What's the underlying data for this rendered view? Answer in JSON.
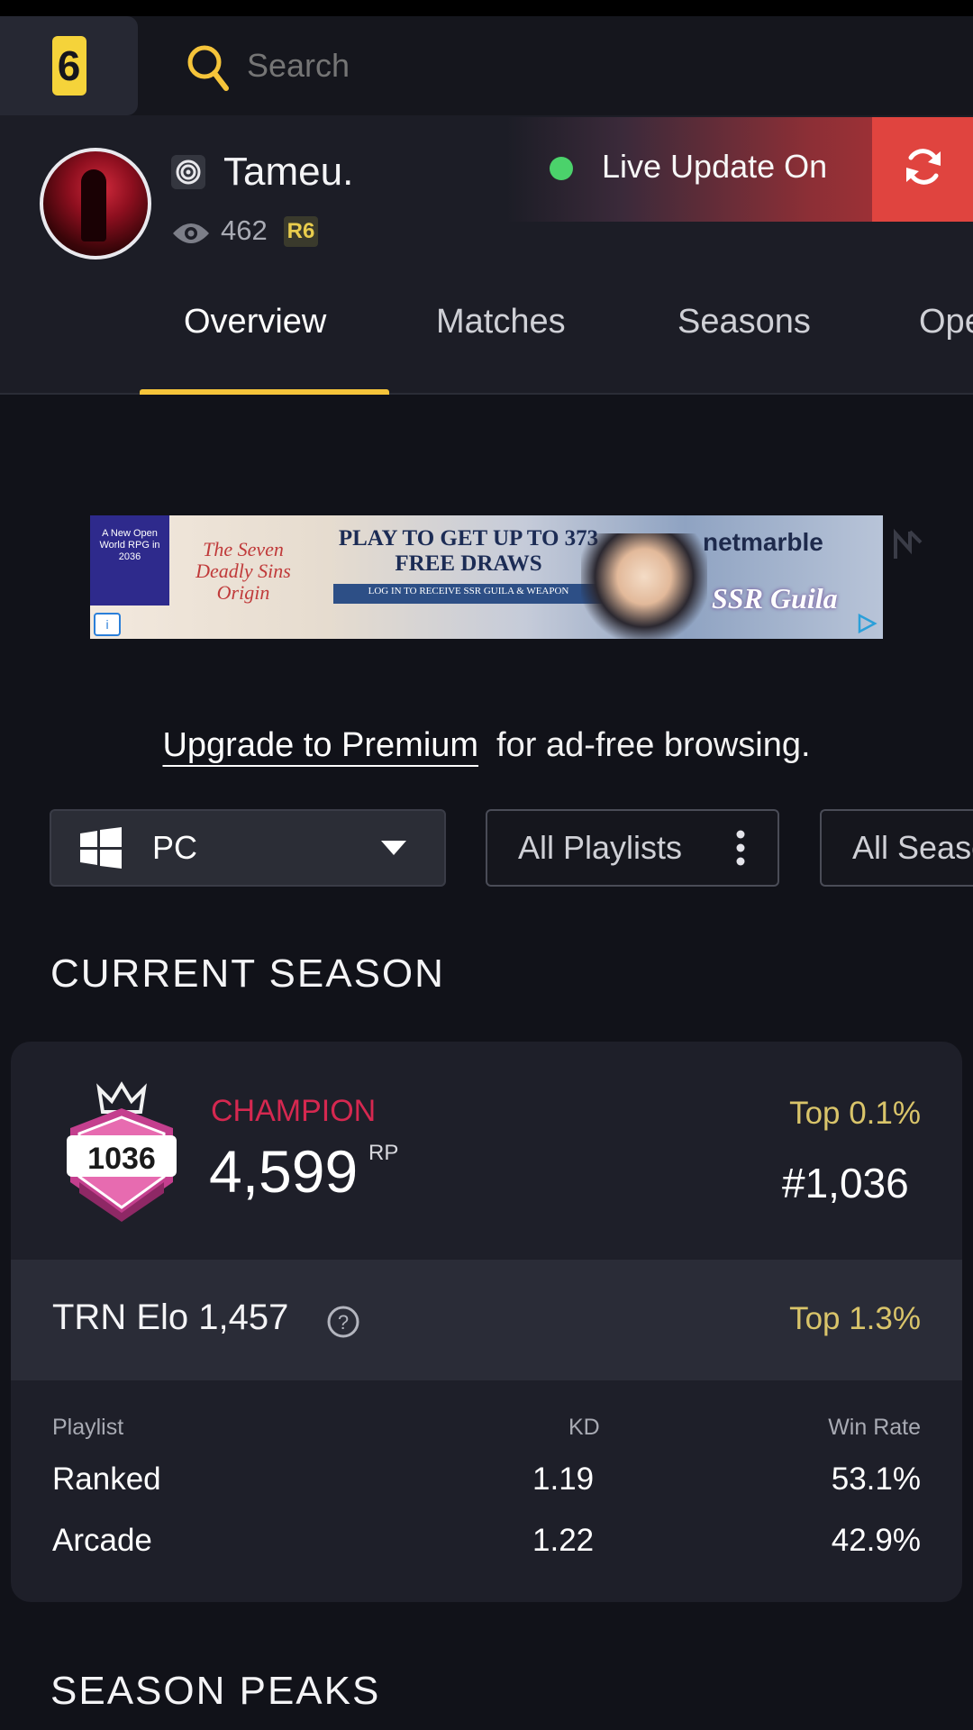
{
  "search": {
    "placeholder": "Search"
  },
  "profile": {
    "username": "Tameu.",
    "views": "462",
    "game_badge": "R6",
    "live_status": "Live Update On"
  },
  "tabs": [
    {
      "label": "Overview",
      "active": true
    },
    {
      "label": "Matches"
    },
    {
      "label": "Seasons"
    },
    {
      "label": "Operators"
    }
  ],
  "ad": {
    "badge": "A New Open World RPG in 2036",
    "game": "The Seven Deadly Sins Origin",
    "headline": "PLAY TO GET UP TO 373 FREE DRAWS",
    "subline": "LOG IN TO RECEIVE SSR GUILA & WEAPON",
    "brand": "netmarble",
    "character": "SSR Guila"
  },
  "upgrade": {
    "link": "Upgrade to Premium",
    "rest": "for ad-free browsing."
  },
  "filters": {
    "platform": "PC",
    "playlists": "All Playlists",
    "seasons": "All Seasons"
  },
  "current_season": {
    "title": "CURRENT SEASON",
    "rank_badge_number": "1036",
    "rank_name": "CHAMPION",
    "rp": "4,599",
    "rp_unit": "RP",
    "top_percent": "Top 0.1%",
    "leaderboard_rank": "#1,036",
    "elo_label": "TRN Elo 1,457",
    "elo_top_percent": "Top 1.3%",
    "columns": [
      "Playlist",
      "KD",
      "Win Rate"
    ],
    "rows": [
      {
        "playlist": "Ranked",
        "kd": "1.19",
        "win_rate": "53.1%"
      },
      {
        "playlist": "Arcade",
        "kd": "1.22",
        "win_rate": "42.9%"
      }
    ]
  },
  "season_peaks": {
    "title": "SEASON PEAKS"
  },
  "colors": {
    "background": "#111219",
    "accent_yellow": "#f5c43a",
    "champion": "#d52850",
    "top_percent": "#d9c46a",
    "live_red": "#e0443f",
    "live_green": "#4bd26b"
  },
  "icons": [
    "r6-logo-icon",
    "search-icon",
    "platform-icon",
    "eye-icon",
    "refresh-icon",
    "windows-icon",
    "caret-down-icon",
    "kebab-menu-icon",
    "champion-rank-icon",
    "help-icon"
  ]
}
